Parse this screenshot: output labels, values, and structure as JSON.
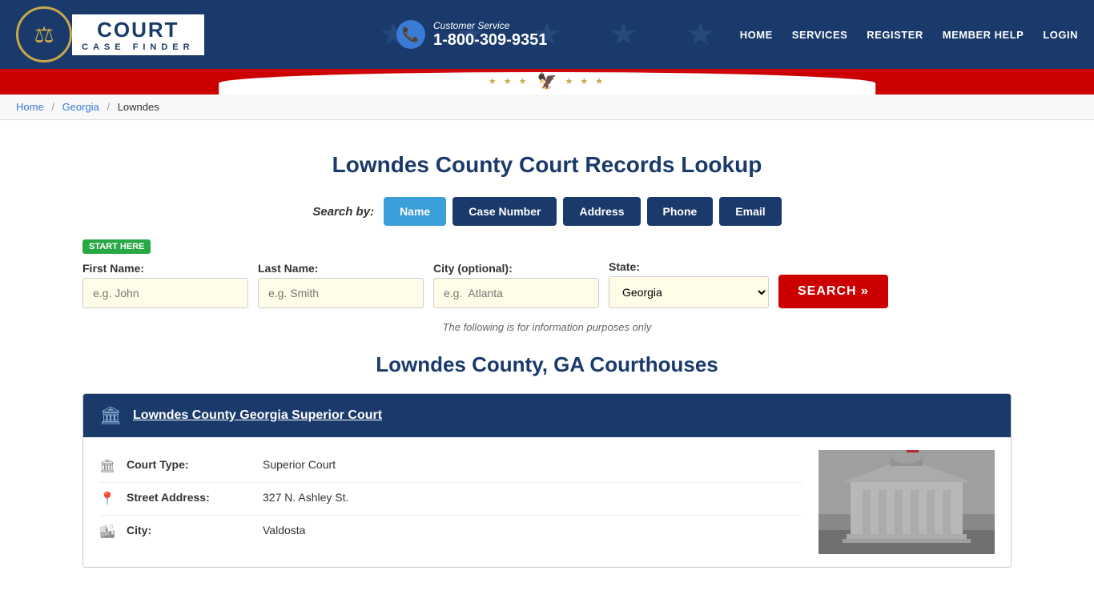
{
  "header": {
    "phone_label": "Customer Service",
    "phone_number": "1-800-309-9351",
    "nav": [
      {
        "label": "HOME",
        "href": "#"
      },
      {
        "label": "SERVICES",
        "href": "#"
      },
      {
        "label": "REGISTER",
        "href": "#"
      },
      {
        "label": "MEMBER HELP",
        "href": "#"
      },
      {
        "label": "LOGIN",
        "href": "#"
      }
    ],
    "logo_court": "COURT",
    "logo_case": "CASE FINDER"
  },
  "breadcrumb": {
    "home": "Home",
    "state": "Georgia",
    "county": "Lowndes"
  },
  "page": {
    "title": "Lowndes County Court Records Lookup",
    "search_by_label": "Search by:",
    "search_tabs": [
      {
        "label": "Name",
        "active": true
      },
      {
        "label": "Case Number",
        "active": false
      },
      {
        "label": "Address",
        "active": false
      },
      {
        "label": "Phone",
        "active": false
      },
      {
        "label": "Email",
        "active": false
      }
    ],
    "start_here": "START HERE",
    "form": {
      "first_name_label": "First Name:",
      "first_name_placeholder": "e.g. John",
      "last_name_label": "Last Name:",
      "last_name_placeholder": "e.g. Smith",
      "city_label": "City (optional):",
      "city_placeholder": "e.g.  Atlanta",
      "state_label": "State:",
      "state_value": "Georgia",
      "search_btn": "SEARCH »"
    },
    "info_note": "The following is for information purposes only",
    "courthouses_title": "Lowndes County, GA Courthouses",
    "courthouse": {
      "name": "Lowndes County Georgia Superior Court",
      "details": [
        {
          "icon": "🏛",
          "label": "Court Type:",
          "value": "Superior Court"
        },
        {
          "icon": "📍",
          "label": "Street Address:",
          "value": "327 N. Ashley St."
        },
        {
          "icon": "🏙",
          "label": "City:",
          "value": "Valdosta"
        }
      ]
    }
  }
}
